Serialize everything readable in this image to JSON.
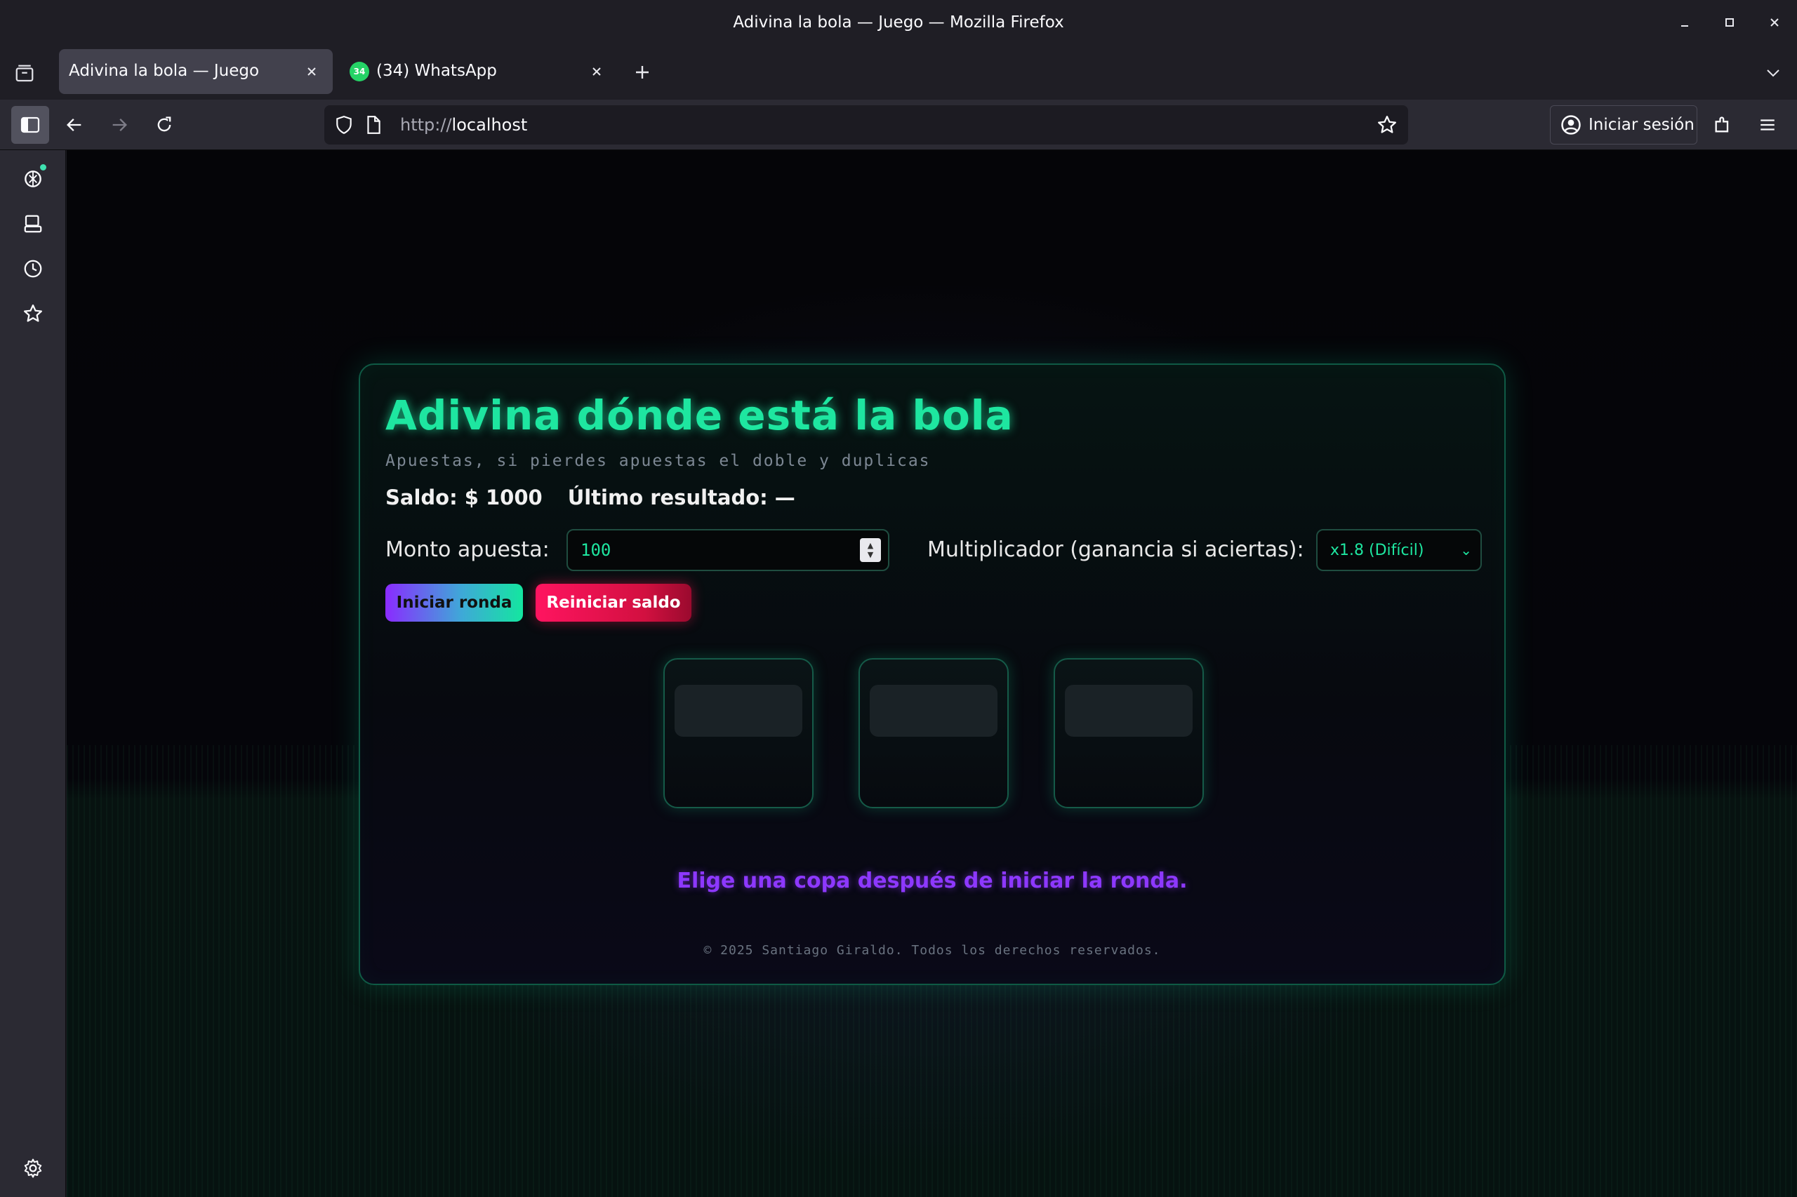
{
  "window": {
    "title": "Adivina la bola — Juego — Mozilla Firefox"
  },
  "tabs": [
    {
      "label": "Adivina la bola — Juego",
      "active": true
    },
    {
      "label": "(34) WhatsApp",
      "active": false,
      "badge": "34"
    }
  ],
  "navbar": {
    "url_scheme": "http://",
    "url_host": "localhost",
    "signin_label": "Iniciar sesión"
  },
  "game": {
    "title": "Adivina dónde está la bola",
    "subtitle": "Apuestas, si pierdes apuestas el doble y duplicas",
    "balance_label": "Saldo:",
    "balance_value": "$ 1000",
    "last_result_label": "Último resultado:",
    "last_result_value": "—",
    "bet_label": "Monto apuesta:",
    "bet_value": "100",
    "multiplier_label": "Multiplicador (ganancia si aciertas):",
    "multiplier_value": "x1.8 (Difícil)",
    "start_button": "Iniciar ronda",
    "reset_button": "Reiniciar saldo",
    "cup_count": 3,
    "message": "Elige una copa después de iniciar la ronda.",
    "footer": "© 2025 Santiago Giraldo. Todos los derechos reservados."
  },
  "colors": {
    "accent_green": "#1ee6a0",
    "accent_purple": "#8d38ff",
    "reset_red": "#ff1460",
    "background": "#05050a"
  },
  "icons": {
    "sidebar": [
      "chatgpt-icon",
      "synced-tabs-icon",
      "history-icon",
      "bookmarks-icon",
      "settings-icon"
    ]
  }
}
